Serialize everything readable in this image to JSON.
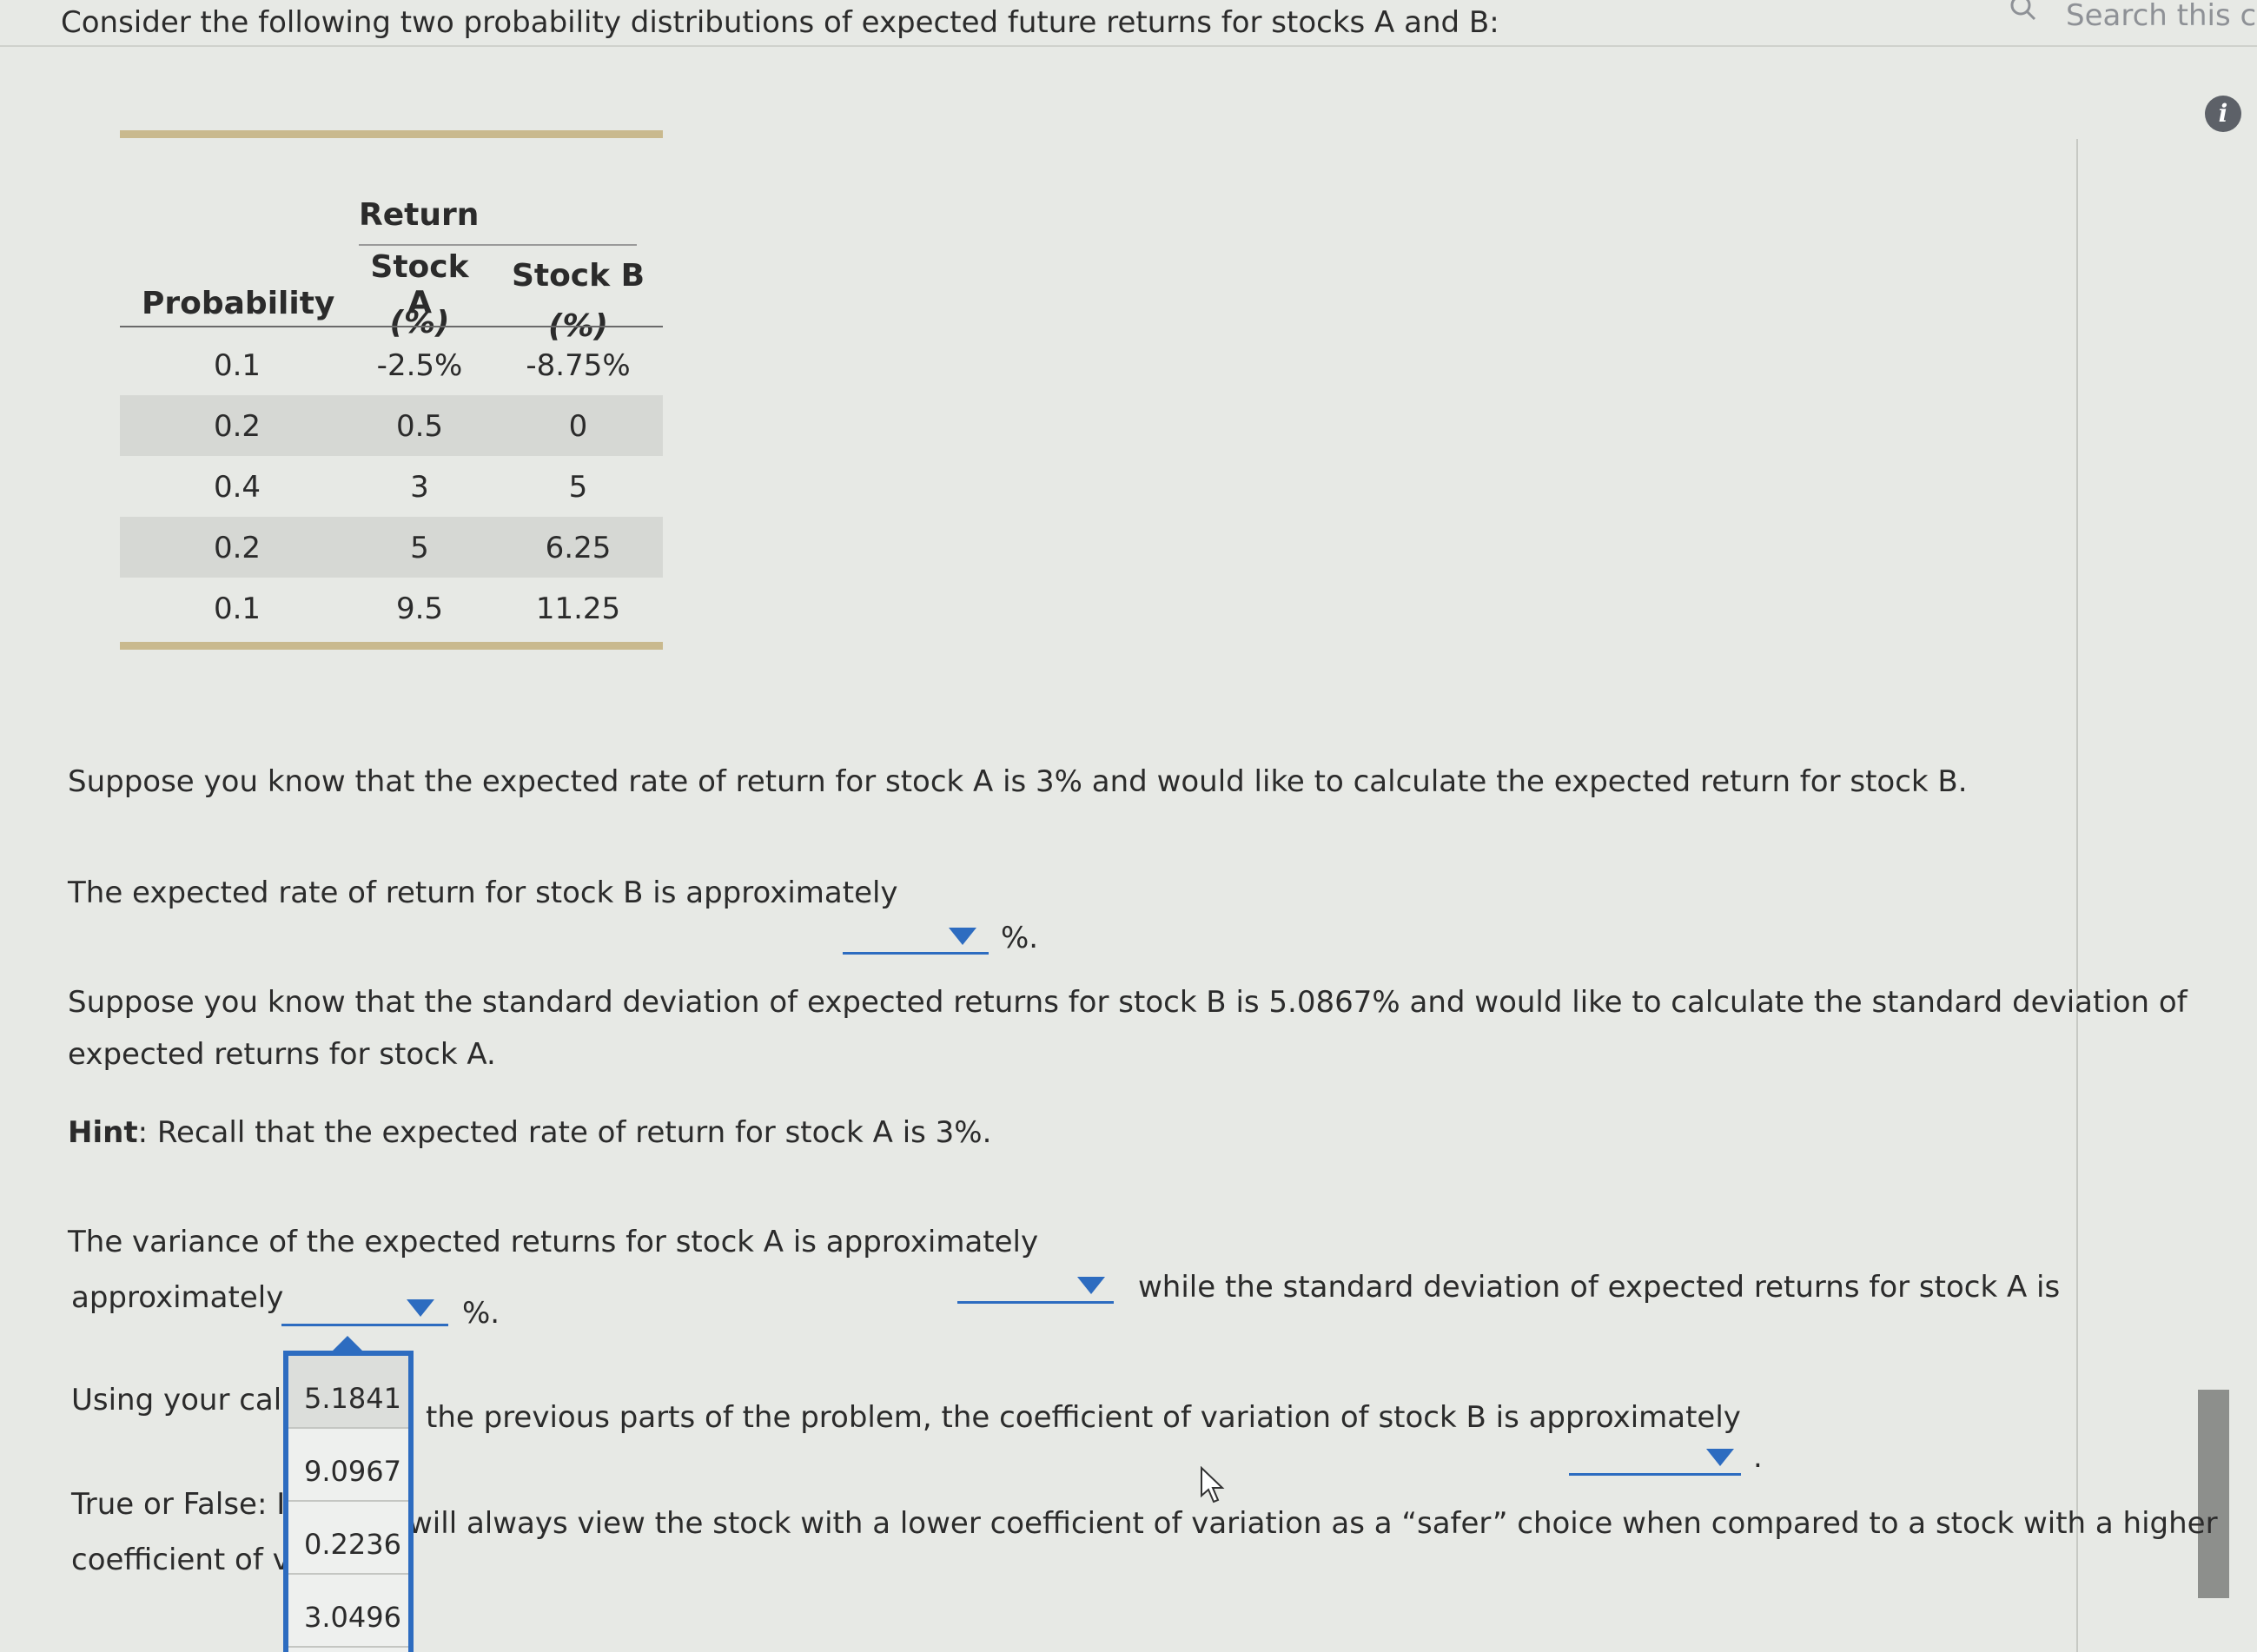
{
  "search": {
    "placeholder": "Search this co"
  },
  "question": {
    "intro": "Consider the following two probability distributions of expected future returns for stocks A and B:"
  },
  "table": {
    "group_header": "Return",
    "col_prob": "Probability",
    "col_a_line1": "Stock A",
    "col_a_line2": "(%)",
    "col_b_line1": "Stock B",
    "col_b_line2": "(%)",
    "rows": [
      {
        "prob": "0.1",
        "a": "-2.5%",
        "b": "-8.75%"
      },
      {
        "prob": "0.2",
        "a": "0.5",
        "b": "0"
      },
      {
        "prob": "0.4",
        "a": "3",
        "b": "5"
      },
      {
        "prob": "0.2",
        "a": "5",
        "b": "6.25"
      },
      {
        "prob": "0.1",
        "a": "9.5",
        "b": "11.25"
      }
    ]
  },
  "p1": "Suppose you know that the expected rate of return for stock A is 3% and would like to calculate the expected return for stock B.",
  "p2": {
    "text": "The expected rate of return for stock B is approximately",
    "suffix": "%."
  },
  "p3": {
    "line1": "Suppose you know that the standard deviation of expected returns for stock B is 5.0867% and would like to calculate the standard deviation of",
    "line2": "expected returns for stock A."
  },
  "hint": {
    "label": "Hint",
    "text": ": Recall that the expected rate of return for stock A is 3%."
  },
  "p4": {
    "text_a": "The variance of the expected returns for stock A is approximately",
    "text_b": "while the standard deviation of expected returns for stock A is",
    "text_c": "approximately",
    "suffix": "%."
  },
  "p5": {
    "left": "Using your calc",
    "right": "the previous parts of the problem, the coefficient of variation of stock B is approximately",
    "suffix": "."
  },
  "p6": {
    "left1": "True or False: I",
    "right1": "will always view the stock with a lower coefficient of variation as a “safer” choice when compared to a stock with a higher",
    "left2": "coefficient of va"
  },
  "dropdown_menu": {
    "options": [
      "5.1841",
      "9.0967",
      "0.2236",
      "3.0496"
    ]
  },
  "colors": {
    "accent": "#2d6cc0",
    "table_rule": "#c9b98e",
    "row_shade": "#d6d8d4"
  },
  "icons": [
    "search-icon",
    "info-icon",
    "chevron-down-icon",
    "mouse-cursor-icon"
  ]
}
